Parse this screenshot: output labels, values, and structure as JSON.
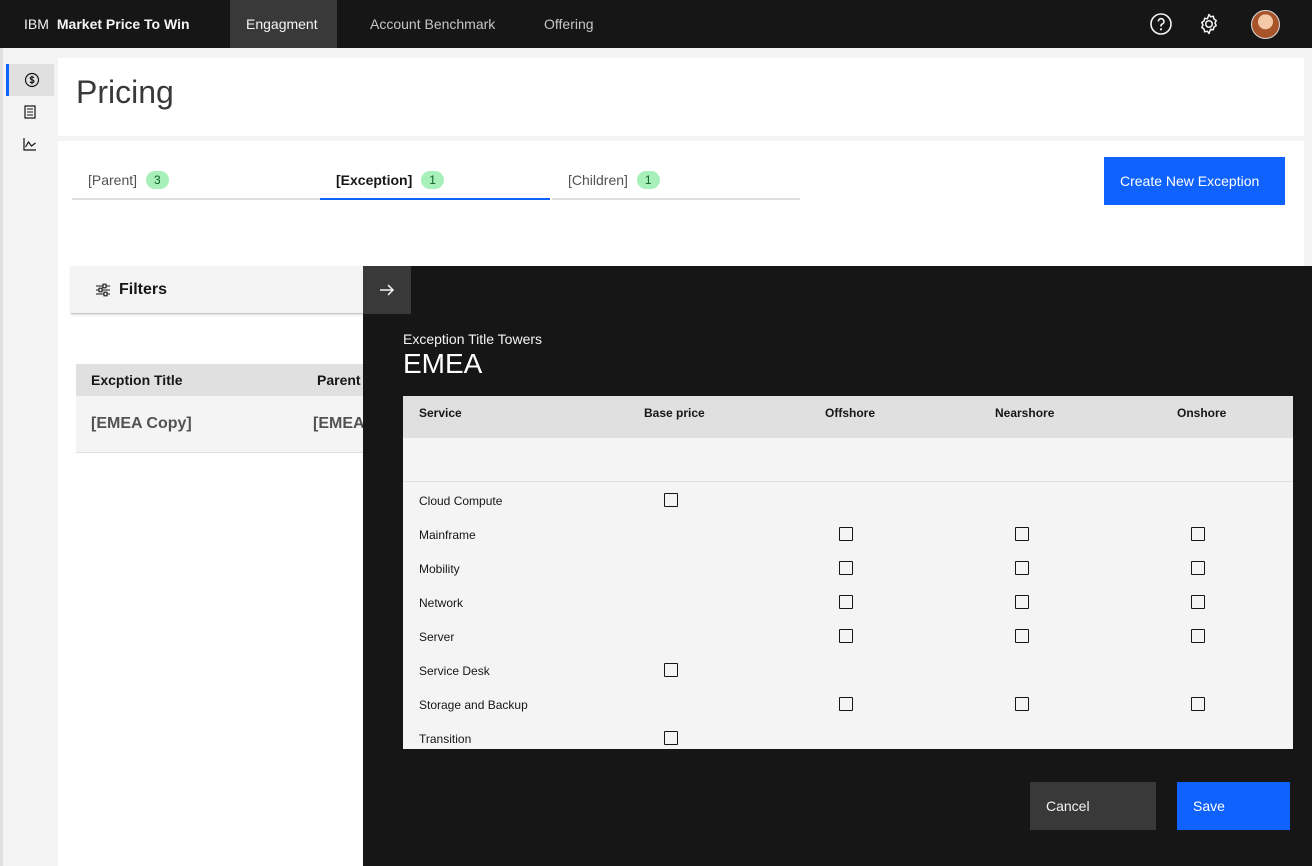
{
  "header": {
    "brand_prefix": "IBM",
    "brand_name": "Market Price To Win",
    "nav": [
      {
        "label": "Engagment",
        "active": true
      },
      {
        "label": "Account Benchmark",
        "active": false
      },
      {
        "label": "Offering",
        "active": false
      }
    ],
    "icons": [
      "help-icon",
      "settings-icon",
      "user-avatar"
    ]
  },
  "rail": {
    "items": [
      "currency-icon",
      "document-list-icon",
      "chart-icon"
    ]
  },
  "page": {
    "title": "Pricing"
  },
  "tabs": [
    {
      "label": "[Parent]",
      "count": "3",
      "active": false
    },
    {
      "label": "[Exception]",
      "count": "1",
      "active": true
    },
    {
      "label": "[Children]",
      "count": "1",
      "active": false
    }
  ],
  "create_button": "Create New Exception",
  "filters_label": "Filters",
  "bg_table": {
    "headers": [
      "Excption Title",
      "Parent"
    ],
    "row": [
      "[EMEA Copy]",
      "[EMEA"
    ]
  },
  "panel": {
    "label": "Exception Title Towers",
    "title": "EMEA",
    "columns": [
      "Service",
      "Base price",
      "Offshore",
      "Nearshore",
      "Onshore"
    ],
    "rows": [
      {
        "service": "Cloud Compute",
        "base": true,
        "off": false,
        "near": false,
        "on": false
      },
      {
        "service": "Mainframe",
        "base": false,
        "off": true,
        "near": true,
        "on": true
      },
      {
        "service": "Mobility",
        "base": false,
        "off": true,
        "near": true,
        "on": true
      },
      {
        "service": "Network",
        "base": false,
        "off": true,
        "near": true,
        "on": true
      },
      {
        "service": "Server",
        "base": false,
        "off": true,
        "near": true,
        "on": true
      },
      {
        "service": "Service Desk",
        "base": true,
        "off": false,
        "near": false,
        "on": false
      },
      {
        "service": "Storage and Backup",
        "base": false,
        "off": true,
        "near": true,
        "on": true
      },
      {
        "service": "Transition",
        "base": true,
        "off": false,
        "near": false,
        "on": false
      }
    ],
    "cancel_label": "Cancel",
    "save_label": "Save"
  },
  "colors": {
    "header_bg": "#161616",
    "accent": "#0f62fe",
    "tag_bg": "#a7f0ba",
    "panel_bg": "#161616"
  }
}
